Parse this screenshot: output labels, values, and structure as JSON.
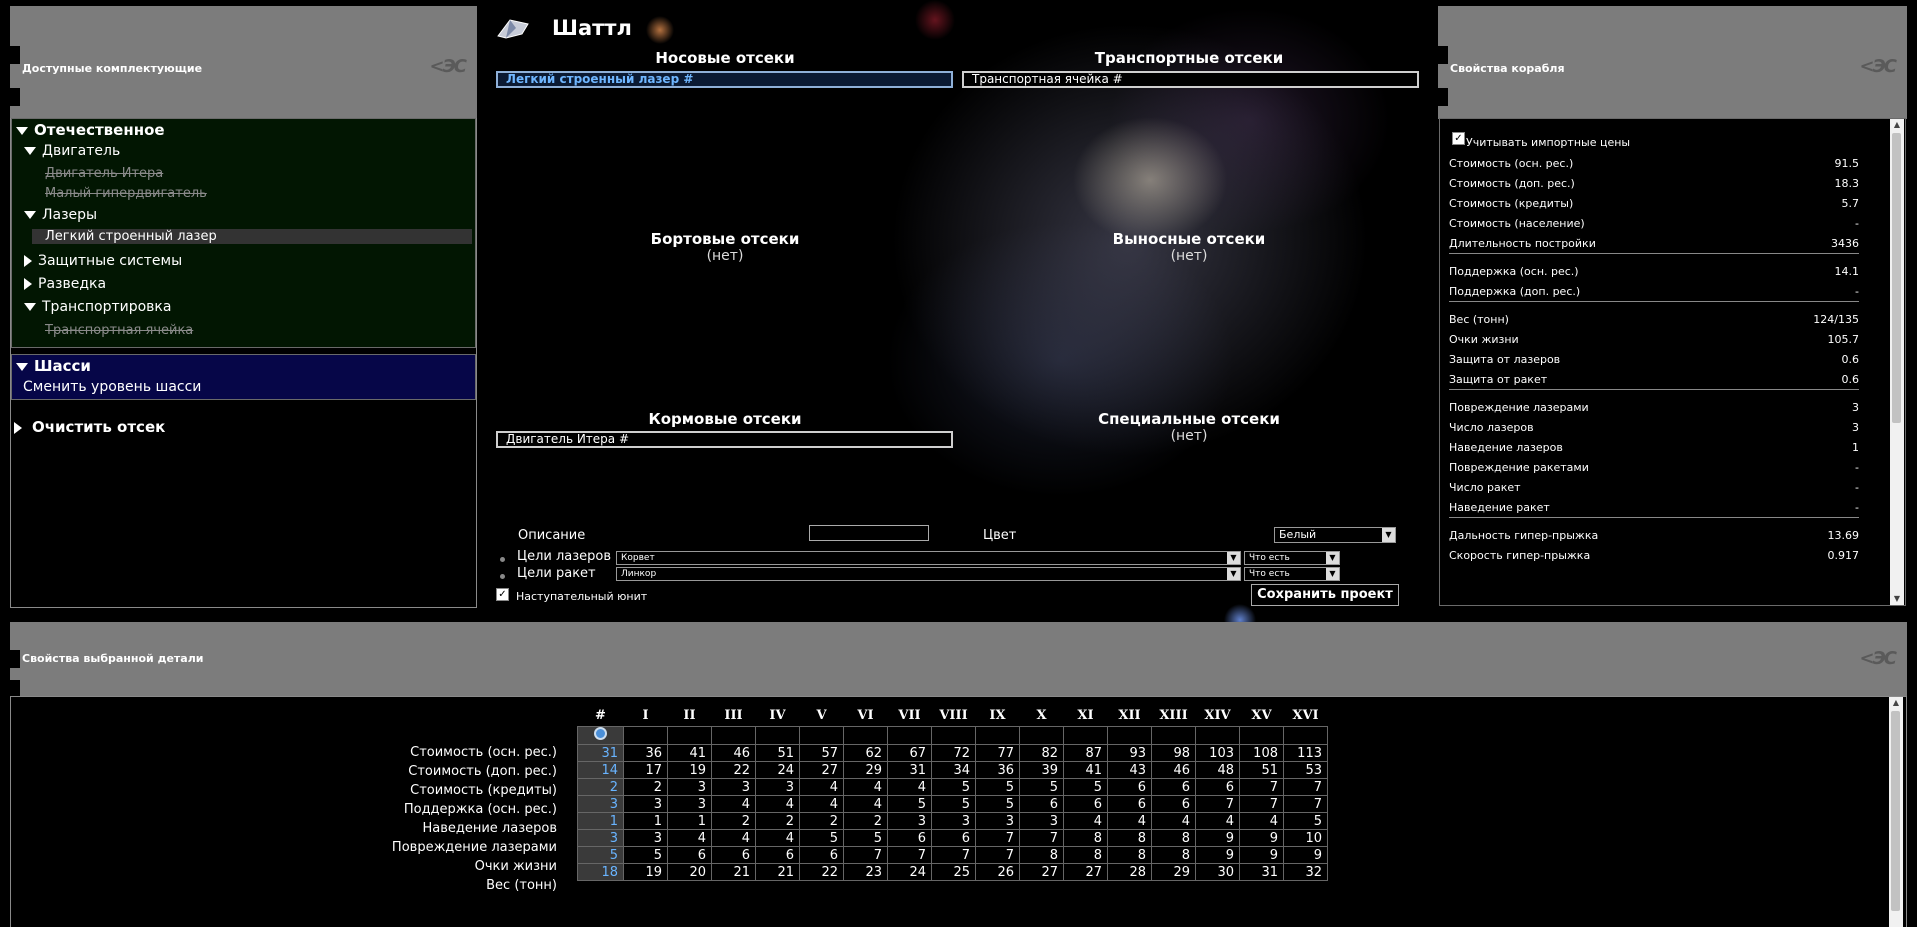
{
  "left_panel": {
    "title": "Доступные комплектующие",
    "tree": [
      {
        "label": "Отечественное",
        "expanded": true
      },
      {
        "label": "Двигатель",
        "expanded": true
      },
      {
        "label": "Двигатель Итера",
        "disabled": true
      },
      {
        "label": "Малый гипердвигатель",
        "disabled": true
      },
      {
        "label": "Лазеры",
        "expanded": true
      },
      {
        "label": "Легкий строенный лазер",
        "selected": true
      },
      {
        "label": "Защитные системы",
        "expanded": false
      },
      {
        "label": "Разведка",
        "expanded": false
      },
      {
        "label": "Транспортировка",
        "expanded": true
      },
      {
        "label": "Транспортная ячейка",
        "disabled": true
      }
    ],
    "chassis": {
      "label": "Шасси",
      "action": "Сменить уровень шасси"
    },
    "clear": "Очистить отсек"
  },
  "ship": {
    "name": "Шаттл",
    "sections": {
      "nose": {
        "title": "Носовые отсеки",
        "slot": "Легкий строенный лазер #"
      },
      "transport": {
        "title": "Транспортные отсеки",
        "slot": "Транспортная ячейка #"
      },
      "side": {
        "title": "Бортовые отсеки",
        "sub": "(нет)"
      },
      "outrigger": {
        "title": "Выносные отсеки",
        "sub": "(нет)"
      },
      "stern": {
        "title": "Кормовые отсеки",
        "slot": "Двигатель Итера #"
      },
      "special": {
        "title": "Специальные отсеки",
        "sub": "(нет)"
      }
    },
    "form": {
      "description_label": "Описание",
      "description_value": "",
      "color_label": "Цвет",
      "color_value": "Белый",
      "laser_targets_label": "Цели лазеров",
      "laser_targets_value": "Корвет",
      "laser_targets_mode": "Что есть",
      "missile_targets_label": "Цели ракет",
      "missile_targets_value": "Линкор",
      "missile_targets_mode": "Что есть",
      "offensive_label": "Наступательный юнит",
      "offensive_checked": true,
      "save_button": "Сохранить проект"
    }
  },
  "props_panel": {
    "title": "Свойства корабля",
    "import_label": "Учитывать импортные цены",
    "import_checked": true,
    "groups": [
      [
        {
          "label": "Стоимость (осн. рес.)",
          "value": "91.5"
        },
        {
          "label": "Стоимость (доп. рес.)",
          "value": "18.3"
        },
        {
          "label": "Стоимость (кредиты)",
          "value": "5.7"
        },
        {
          "label": "Стоимость (население)",
          "value": "-"
        },
        {
          "label": "Длительность постройки",
          "value": "3436"
        }
      ],
      [
        {
          "label": "Поддержка (осн. рес.)",
          "value": "14.1"
        },
        {
          "label": "Поддержка (доп. рес.)",
          "value": "-"
        }
      ],
      [
        {
          "label": "Вес (тонн)",
          "value": "124/135"
        },
        {
          "label": "Очки жизни",
          "value": "105.7"
        },
        {
          "label": "Защита от лазеров",
          "value": "0.6"
        },
        {
          "label": "Защита от ракет",
          "value": "0.6"
        }
      ],
      [
        {
          "label": "Повреждение лазерами",
          "value": "3"
        },
        {
          "label": "Число лазеров",
          "value": "3"
        },
        {
          "label": "Наведение лазеров",
          "value": "1"
        },
        {
          "label": "Повреждение ракетами",
          "value": "-"
        },
        {
          "label": "Число ракет",
          "value": "-"
        },
        {
          "label": "Наведение ракет",
          "value": "-"
        }
      ],
      [
        {
          "label": "Дальность гипер-прыжка",
          "value": "13.69"
        },
        {
          "label": "Скорость гипер-прыжка",
          "value": "0.917"
        }
      ]
    ]
  },
  "detail_panel": {
    "title": "Свойства выбранной детали",
    "columns": [
      "#",
      "I",
      "II",
      "III",
      "IV",
      "V",
      "VI",
      "VII",
      "VIII",
      "IX",
      "X",
      "XI",
      "XII",
      "XIII",
      "XIV",
      "XV",
      "XVI"
    ],
    "rows": [
      {
        "label": "Стоимость (осн. рес.)",
        "current": "31",
        "values": [
          "36",
          "41",
          "46",
          "51",
          "57",
          "62",
          "67",
          "72",
          "77",
          "82",
          "87",
          "93",
          "98",
          "103",
          "108",
          "113"
        ]
      },
      {
        "label": "Стоимость (доп. рес.)",
        "current": "14",
        "values": [
          "17",
          "19",
          "22",
          "24",
          "27",
          "29",
          "31",
          "34",
          "36",
          "39",
          "41",
          "43",
          "46",
          "48",
          "51",
          "53"
        ]
      },
      {
        "label": "Стоимость (кредиты)",
        "current": "2",
        "values": [
          "2",
          "3",
          "3",
          "3",
          "4",
          "4",
          "4",
          "5",
          "5",
          "5",
          "5",
          "6",
          "6",
          "6",
          "7",
          "7"
        ]
      },
      {
        "label": "Поддержка (осн. рес.)",
        "current": "3",
        "values": [
          "3",
          "3",
          "4",
          "4",
          "4",
          "4",
          "5",
          "5",
          "5",
          "6",
          "6",
          "6",
          "6",
          "7",
          "7",
          "7"
        ]
      },
      {
        "label": "Наведение лазеров",
        "current": "1",
        "values": [
          "1",
          "1",
          "2",
          "2",
          "2",
          "2",
          "3",
          "3",
          "3",
          "3",
          "4",
          "4",
          "4",
          "4",
          "4",
          "5"
        ]
      },
      {
        "label": "Повреждение лазерами",
        "current": "3",
        "values": [
          "3",
          "4",
          "4",
          "4",
          "5",
          "5",
          "6",
          "6",
          "7",
          "7",
          "8",
          "8",
          "8",
          "9",
          "9",
          "10"
        ]
      },
      {
        "label": "Очки жизни",
        "current": "5",
        "values": [
          "5",
          "6",
          "6",
          "6",
          "6",
          "7",
          "7",
          "7",
          "7",
          "8",
          "8",
          "8",
          "8",
          "9",
          "9",
          "9"
        ]
      },
      {
        "label": "Вес (тонн)",
        "current": "18",
        "values": [
          "19",
          "20",
          "21",
          "21",
          "22",
          "23",
          "24",
          "25",
          "26",
          "27",
          "27",
          "28",
          "29",
          "30",
          "31",
          "32"
        ]
      }
    ]
  }
}
